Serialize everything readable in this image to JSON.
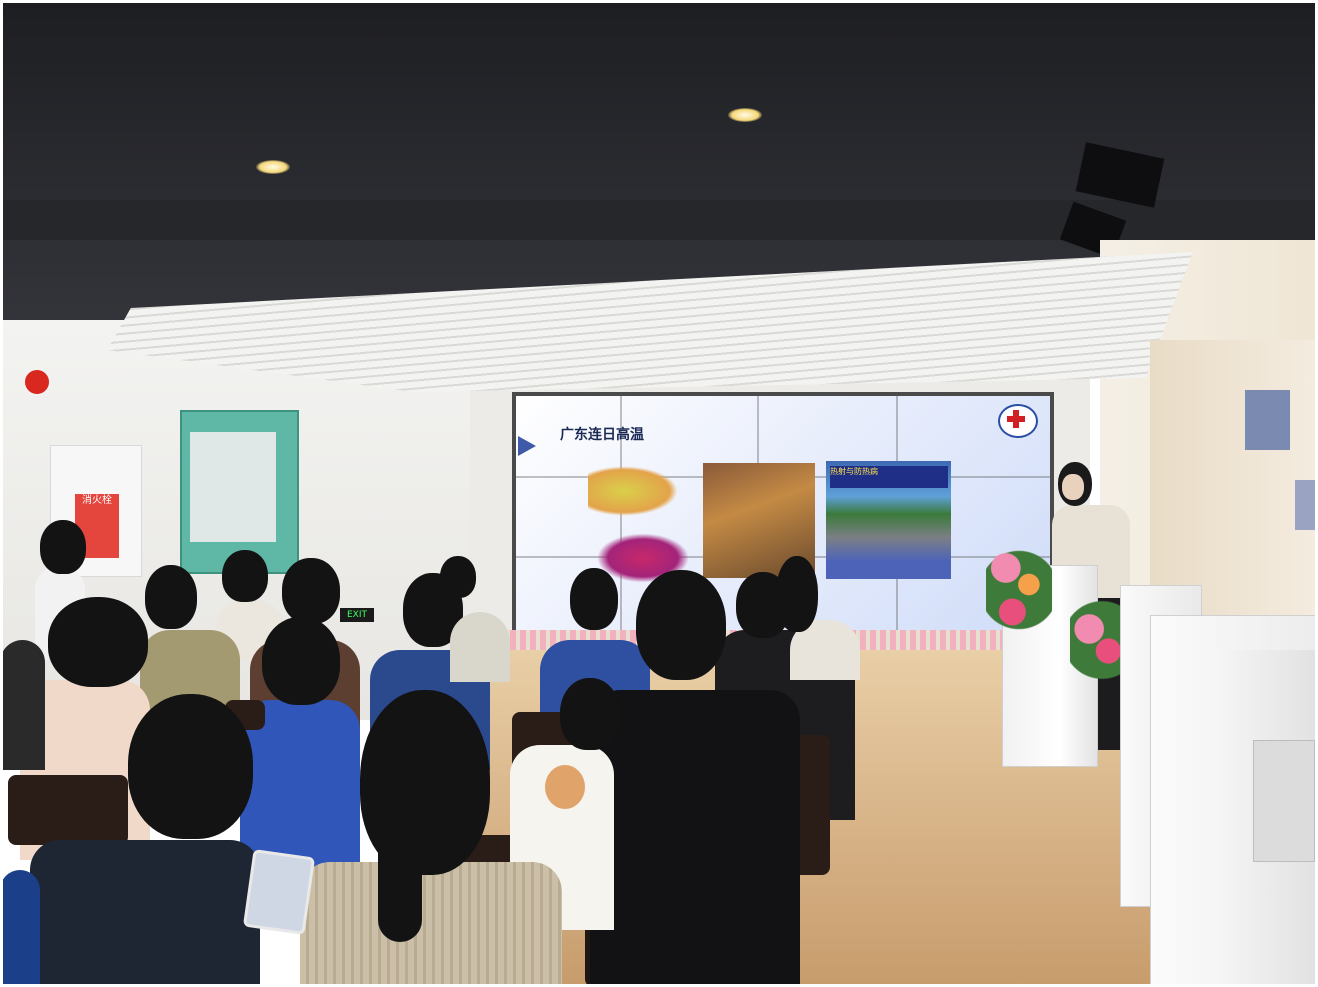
{
  "photo": {
    "subject": "",
    "slide": {
      "title": "广东连日高温",
      "image2_caption": "热射与防热病"
    },
    "signs": {
      "poster_text": "消火栓",
      "exit_sign": "EXIT"
    },
    "colors": {
      "ceiling": "#1d1e22",
      "screen_bg": "#e9eefc",
      "floor": "#d8b489",
      "slide_title": "#1b2a55",
      "red_cross": "#d21f24"
    }
  }
}
